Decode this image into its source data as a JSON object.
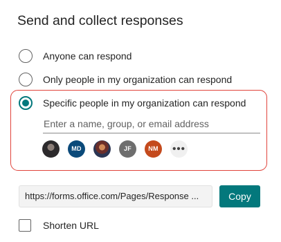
{
  "title": "Send and collect responses",
  "audience_options": [
    {
      "label": "Anyone can respond",
      "checked": false
    },
    {
      "label": "Only people in my organization can respond",
      "checked": false
    },
    {
      "label": "Specific people in my organization can respond",
      "checked": true
    }
  ],
  "people_picker": {
    "placeholder": "Enter a name, group, or email address",
    "value": ""
  },
  "avatars": [
    {
      "initials": "",
      "kind": "photo",
      "color": "#2c2a2c"
    },
    {
      "initials": "MD",
      "kind": "initials",
      "color": "#0b4a7a"
    },
    {
      "initials": "",
      "kind": "photo",
      "color": "#6b2e2a"
    },
    {
      "initials": "JF",
      "kind": "initials",
      "color": "#6e6e6e"
    },
    {
      "initials": "NM",
      "kind": "initials",
      "color": "#c44a1d"
    }
  ],
  "more_label": "•••",
  "share_link": {
    "url": "https://forms.office.com/Pages/Response ...",
    "copy_label": "Copy"
  },
  "shorten_url": {
    "label": "Shorten URL",
    "checked": false
  },
  "colors": {
    "accent": "#03787c",
    "highlight": "#e0433b"
  }
}
